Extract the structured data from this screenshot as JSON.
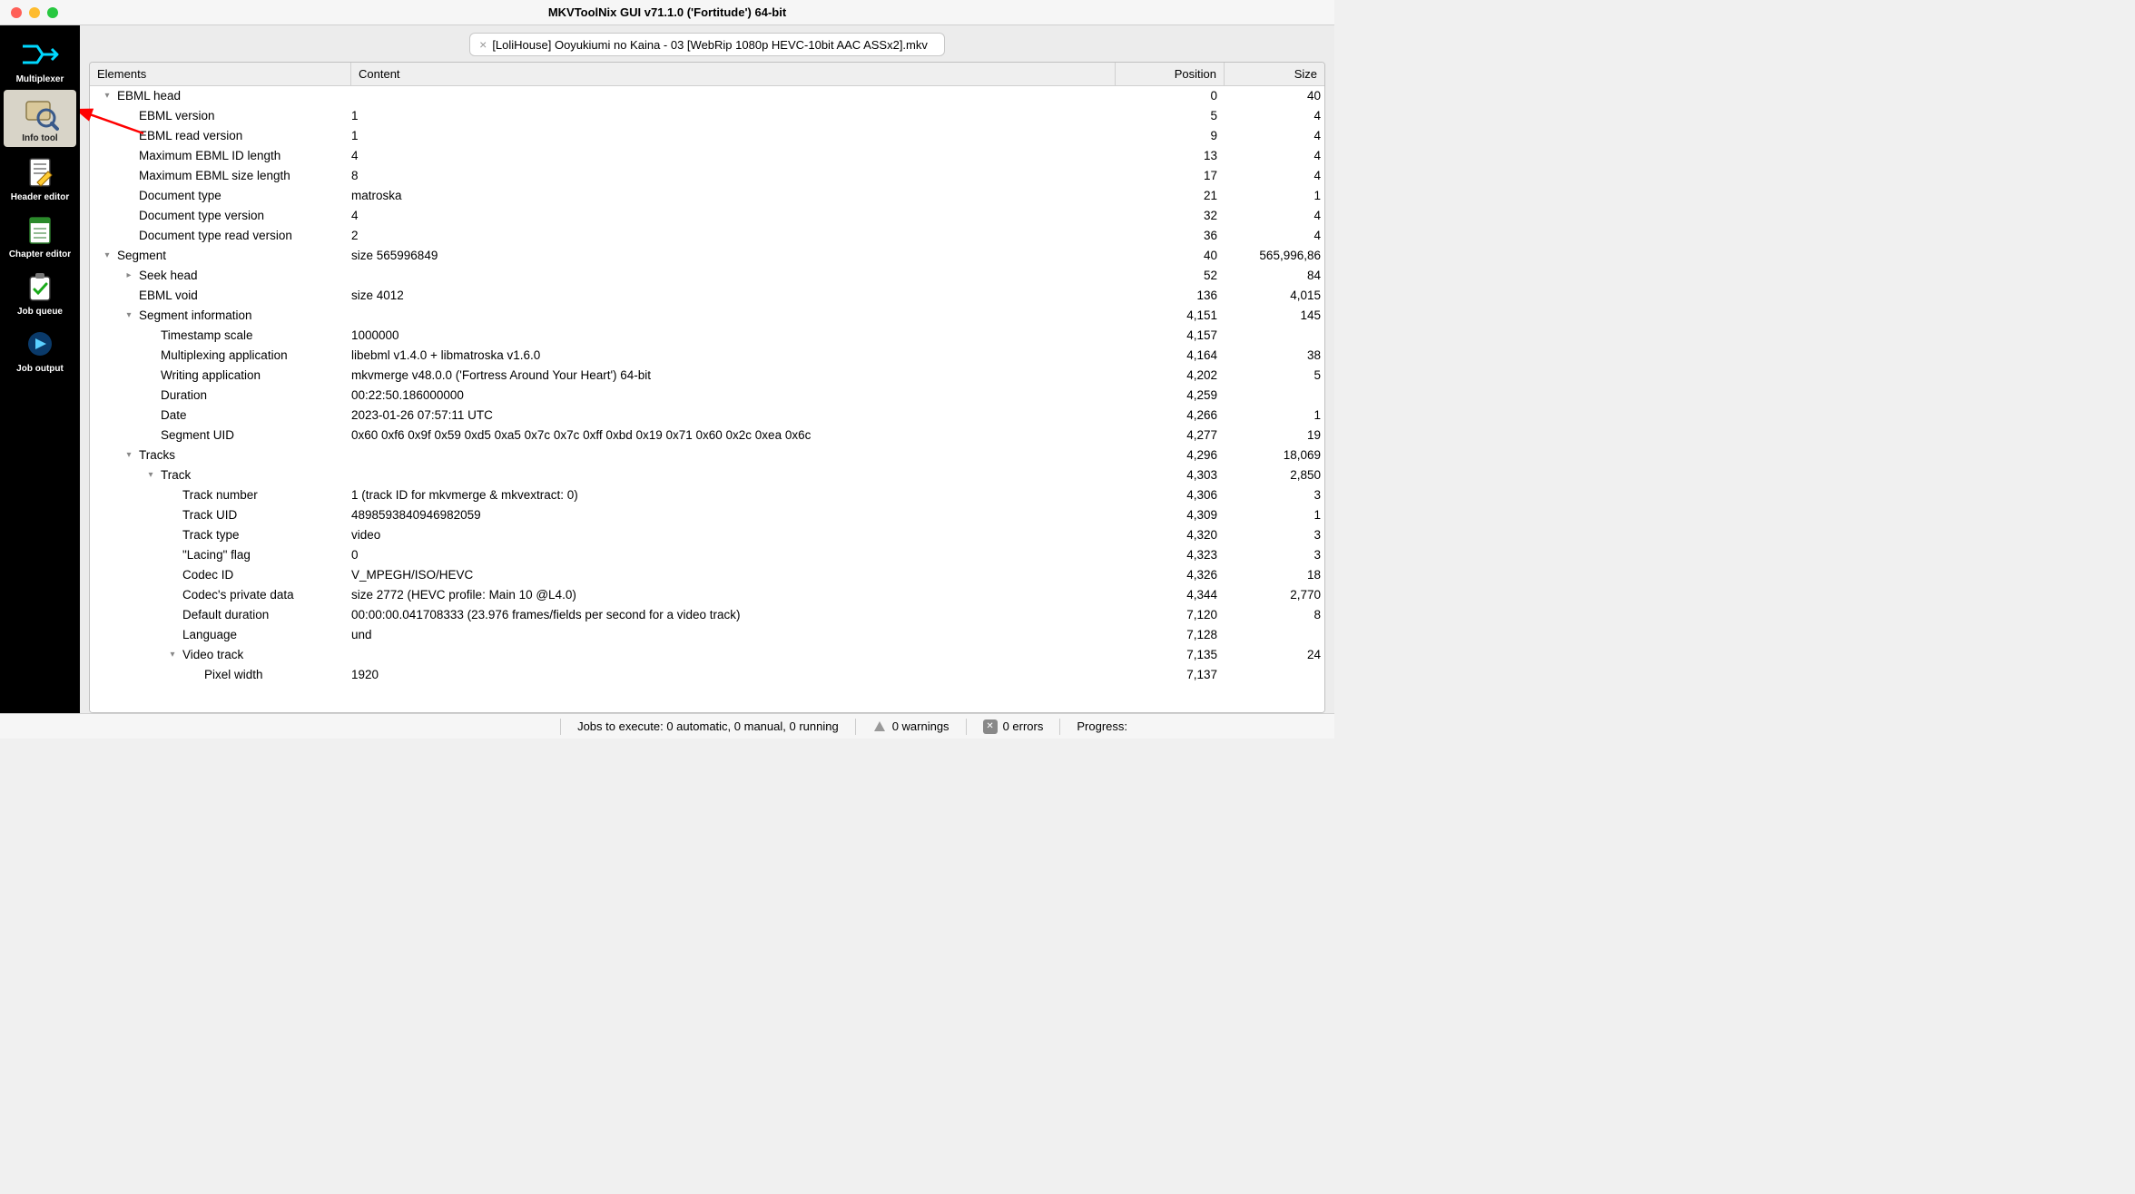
{
  "window": {
    "title": "MKVToolNix GUI v71.1.0 ('Fortitude') 64-bit"
  },
  "sidebar": {
    "items": [
      {
        "label": "Multiplexer",
        "active": false
      },
      {
        "label": "Info tool",
        "active": true
      },
      {
        "label": "Header editor",
        "active": false
      },
      {
        "label": "Chapter editor",
        "active": false
      },
      {
        "label": "Job queue",
        "active": false
      },
      {
        "label": "Job output",
        "active": false
      }
    ]
  },
  "tab": {
    "title": "[LoliHouse] Ooyukiumi no Kaina - 03 [WebRip 1080p HEVC-10bit AAC ASSx2].mkv"
  },
  "columns": {
    "elements": "Elements",
    "content": "Content",
    "position": "Position",
    "size": "Size"
  },
  "rows": [
    {
      "indent": 0,
      "disclosure": "down",
      "element": "EBML head",
      "content": "",
      "position": "0",
      "size": "40"
    },
    {
      "indent": 1,
      "disclosure": "",
      "element": "EBML version",
      "content": "1",
      "position": "5",
      "size": "4"
    },
    {
      "indent": 1,
      "disclosure": "",
      "element": "EBML read version",
      "content": "1",
      "position": "9",
      "size": "4"
    },
    {
      "indent": 1,
      "disclosure": "",
      "element": "Maximum EBML ID length",
      "content": "4",
      "position": "13",
      "size": "4"
    },
    {
      "indent": 1,
      "disclosure": "",
      "element": "Maximum EBML size length",
      "content": "8",
      "position": "17",
      "size": "4"
    },
    {
      "indent": 1,
      "disclosure": "",
      "element": "Document type",
      "content": "matroska",
      "position": "21",
      "size": "1"
    },
    {
      "indent": 1,
      "disclosure": "",
      "element": "Document type version",
      "content": "4",
      "position": "32",
      "size": "4"
    },
    {
      "indent": 1,
      "disclosure": "",
      "element": "Document type read version",
      "content": "2",
      "position": "36",
      "size": "4"
    },
    {
      "indent": 0,
      "disclosure": "down",
      "element": "Segment",
      "content": "size 565996849",
      "position": "40",
      "size": "565,996,86"
    },
    {
      "indent": 1,
      "disclosure": "right",
      "element": "Seek head",
      "content": "",
      "position": "52",
      "size": "84"
    },
    {
      "indent": 1,
      "disclosure": "",
      "element": "EBML void",
      "content": "size 4012",
      "position": "136",
      "size": "4,015"
    },
    {
      "indent": 1,
      "disclosure": "down",
      "element": "Segment information",
      "content": "",
      "position": "4,151",
      "size": "145"
    },
    {
      "indent": 2,
      "disclosure": "",
      "element": "Timestamp scale",
      "content": "1000000",
      "position": "4,157",
      "size": ""
    },
    {
      "indent": 2,
      "disclosure": "",
      "element": "Multiplexing application",
      "content": "libebml v1.4.0 + libmatroska v1.6.0",
      "position": "4,164",
      "size": "38"
    },
    {
      "indent": 2,
      "disclosure": "",
      "element": "Writing application",
      "content": "mkvmerge v48.0.0 ('Fortress Around Your Heart') 64-bit",
      "position": "4,202",
      "size": "5"
    },
    {
      "indent": 2,
      "disclosure": "",
      "element": "Duration",
      "content": "00:22:50.186000000",
      "position": "4,259",
      "size": ""
    },
    {
      "indent": 2,
      "disclosure": "",
      "element": "Date",
      "content": "2023-01-26 07:57:11 UTC",
      "position": "4,266",
      "size": "1"
    },
    {
      "indent": 2,
      "disclosure": "",
      "element": "Segment UID",
      "content": "0x60 0xf6 0x9f 0x59 0xd5 0xa5 0x7c 0x7c 0xff 0xbd 0x19 0x71 0x60 0x2c 0xea 0x6c",
      "position": "4,277",
      "size": "19"
    },
    {
      "indent": 1,
      "disclosure": "down",
      "element": "Tracks",
      "content": "",
      "position": "4,296",
      "size": "18,069"
    },
    {
      "indent": 2,
      "disclosure": "down",
      "element": "Track",
      "content": "",
      "position": "4,303",
      "size": "2,850"
    },
    {
      "indent": 3,
      "disclosure": "",
      "element": "Track number",
      "content": "1 (track ID for mkvmerge & mkvextract: 0)",
      "position": "4,306",
      "size": "3"
    },
    {
      "indent": 3,
      "disclosure": "",
      "element": "Track UID",
      "content": "4898593840946982059",
      "position": "4,309",
      "size": "1"
    },
    {
      "indent": 3,
      "disclosure": "",
      "element": "Track type",
      "content": "video",
      "position": "4,320",
      "size": "3"
    },
    {
      "indent": 3,
      "disclosure": "",
      "element": "\"Lacing\" flag",
      "content": "0",
      "position": "4,323",
      "size": "3"
    },
    {
      "indent": 3,
      "disclosure": "",
      "element": "Codec ID",
      "content": "V_MPEGH/ISO/HEVC",
      "position": "4,326",
      "size": "18"
    },
    {
      "indent": 3,
      "disclosure": "",
      "element": "Codec's private data",
      "content": "size 2772 (HEVC profile: Main 10 @L4.0)",
      "position": "4,344",
      "size": "2,770"
    },
    {
      "indent": 3,
      "disclosure": "",
      "element": "Default duration",
      "content": "00:00:00.041708333 (23.976 frames/fields per second for a video track)",
      "position": "7,120",
      "size": "8"
    },
    {
      "indent": 3,
      "disclosure": "",
      "element": "Language",
      "content": "und",
      "position": "7,128",
      "size": ""
    },
    {
      "indent": 3,
      "disclosure": "down",
      "element": "Video track",
      "content": "",
      "position": "7,135",
      "size": "24"
    },
    {
      "indent": 4,
      "disclosure": "",
      "element": "Pixel width",
      "content": "1920",
      "position": "7,137",
      "size": ""
    }
  ],
  "statusbar": {
    "jobs": "Jobs to execute:  0 automatic, 0 manual, 0 running",
    "warnings": "0 warnings",
    "errors": "0 errors",
    "progress": "Progress:"
  }
}
